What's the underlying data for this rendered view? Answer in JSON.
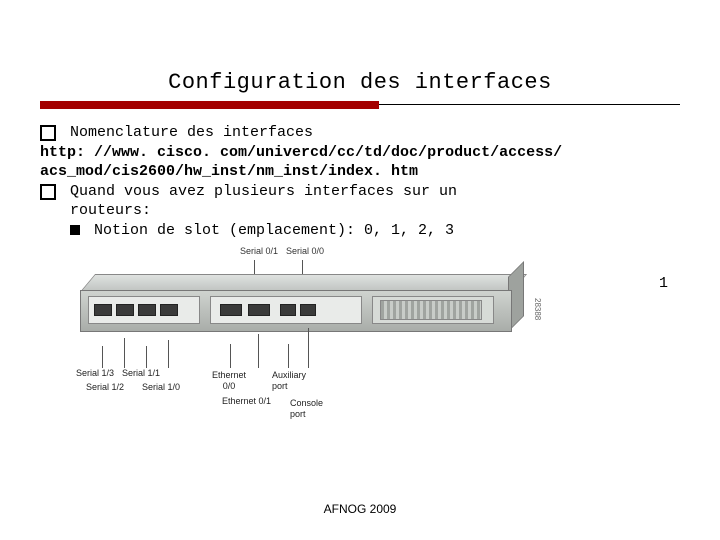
{
  "title": "Configuration des interfaces",
  "bullets": {
    "b1": "Nomenclature des interfaces",
    "url1": "http: //www. cisco. com/univercd/cc/td/doc/product/access/",
    "url2": "acs_mod/cis2600/hw_inst/nm_inst/index. htm",
    "b2a": "Quand vous avez plusieurs interfaces sur un",
    "b2b": "routeurs:",
    "b3": "Notion de slot (emplacement): 0, 1, 2, 3",
    "trailing": "1"
  },
  "diagram": {
    "top_labels": {
      "s01": "Serial 0/1",
      "s00": "Serial 0/0"
    },
    "bottom_labels": {
      "s13": "Serial 1/3",
      "s12": "Serial 1/2",
      "s11": "Serial 1/1",
      "s10": "Serial 1/0",
      "e00": "Ethernet\n0/0",
      "e01": "Ethernet 0/1",
      "aux": "Auxiliary\nport",
      "con": "Console\nport"
    },
    "ref": "28388"
  },
  "footer": "AFNOG 2009"
}
